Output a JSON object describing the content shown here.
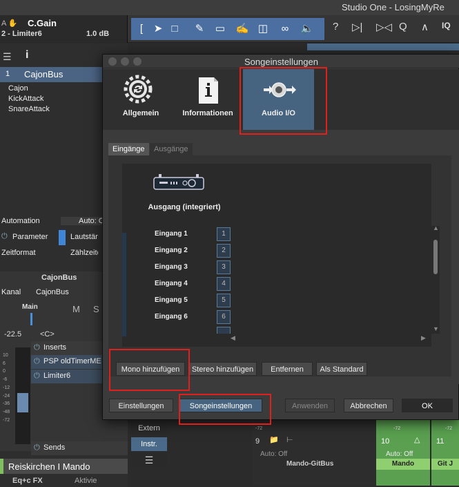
{
  "app": {
    "window_title": "Studio One - LosingMyRe"
  },
  "track_info": {
    "name": "C.Gain",
    "sub": "2 - Limiter6",
    "db": "1.0 dB"
  },
  "left_panel": {
    "folder_track": {
      "num": "1",
      "name": "CajonBus"
    },
    "sub_tracks": [
      "Cajon",
      "KickAttack",
      "SnareAttack"
    ],
    "automation_label": "Automation",
    "automation_value": "Auto: C",
    "parameter_label": "Parameter",
    "parameter_value": "Lautstärk",
    "zeitformat_label": "Zeitformat",
    "zeitformat_value": "Zählzeite",
    "mixer_title": "CajonBus",
    "kanal_label": "Kanal",
    "kanal_value": "CajonBus",
    "main_label": "Main",
    "m_label": "M",
    "s_label": "S",
    "level": "-22.5",
    "pan": "<C>",
    "inserts_label": "Inserts",
    "insert_1": "PSP oldTimerME",
    "insert_2": "Limiter6",
    "sends_label": "Sends",
    "scale": [
      "10",
      "6",
      "0",
      "-6",
      "-12",
      "-24",
      "-36",
      "-48",
      "-72"
    ],
    "bottom_track": "Reiskirchen I Mando",
    "bottom_track_2": "Eq+c FX",
    "bottom_track_3": "Aktivie"
  },
  "bg": {
    "extern": "Extern",
    "instr": "Instr.",
    "strip1_num": "9",
    "strip1_auto": "Auto: Off",
    "strip1_name": "Mando-GitBus",
    "strip2_num": "10",
    "strip2_auto": "Auto: Off",
    "strip2_name": "Mando",
    "strip3_num": "11",
    "strip3_name": "Git J",
    "meter_a": "-72",
    "meter_b": "-72",
    "meter_c": "-72"
  },
  "dialog": {
    "title": "Songeinstellungen",
    "tabs": [
      {
        "label": "Allgemein",
        "icon": "gear-refresh-icon"
      },
      {
        "label": "Informationen",
        "icon": "info-document-icon"
      },
      {
        "label": "Audio I/O",
        "icon": "audio-io-icon"
      }
    ],
    "subtabs": [
      "Eingänge",
      "Ausgänge"
    ],
    "device_name": "Ausgang (integriert)",
    "inputs": [
      {
        "label": "Eingang 1",
        "num": "1"
      },
      {
        "label": "Eingang 2",
        "num": "2"
      },
      {
        "label": "Eingang 3",
        "num": "3"
      },
      {
        "label": "Eingang 4",
        "num": "4"
      },
      {
        "label": "Eingang 5",
        "num": "5"
      },
      {
        "label": "Eingang 6",
        "num": "6"
      }
    ],
    "action_buttons": {
      "mono": "Mono hinzufügen",
      "stereo": "Stereo hinzufügen",
      "remove": "Entfernen",
      "default": "Als Standard"
    },
    "footer": {
      "settings": "Einstellungen",
      "song_settings": "Songeinstellungen",
      "apply": "Anwenden",
      "cancel": "Abbrechen",
      "ok": "OK"
    }
  },
  "colors": {
    "accent_blue": "#46637f",
    "highlight_red": "#e0201c",
    "track_green": "#7fbf5f"
  }
}
